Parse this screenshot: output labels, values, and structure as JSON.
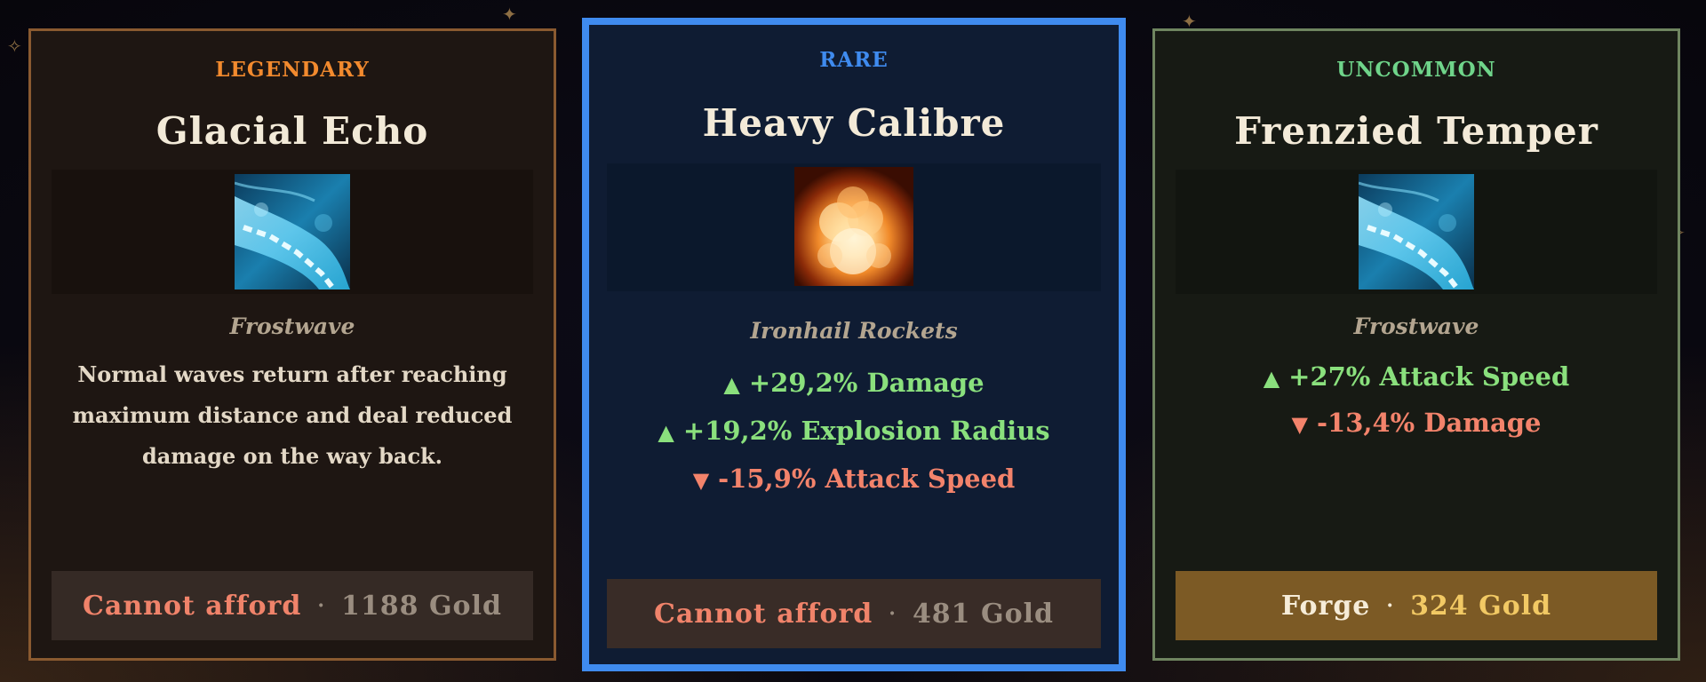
{
  "colors": {
    "legendary": "#f28a2e",
    "rare": "#3f8bef",
    "uncommon": "#6fd48a",
    "stat_up": "#8ae07d",
    "stat_down": "#f3836b",
    "gold": "#f2c964"
  },
  "cards": [
    {
      "rarity": "LEGENDARY",
      "title": "Glacial Echo",
      "icon": "frostwave-icon",
      "weapon": "Frostwave",
      "description": "Normal waves return after reaching maximum distance and deal reduced damage on the way back.",
      "button": {
        "label": "Cannot afford",
        "separator": "·",
        "cost": "1188 Gold",
        "affordable": false
      }
    },
    {
      "rarity": "RARE",
      "title": "Heavy Calibre",
      "icon": "explosion-icon",
      "weapon": "Ironhail Rockets",
      "stats": [
        {
          "direction": "up",
          "arrow": "▲",
          "text": "+29,2% Damage"
        },
        {
          "direction": "up",
          "arrow": "▲",
          "text": "+19,2% Explosion Radius"
        },
        {
          "direction": "down",
          "arrow": "▼",
          "text": "-15,9% Attack Speed"
        }
      ],
      "button": {
        "label": "Cannot afford",
        "separator": "·",
        "cost": "481 Gold",
        "affordable": false
      }
    },
    {
      "rarity": "UNCOMMON",
      "title": "Frenzied Temper",
      "icon": "frostwave-icon",
      "weapon": "Frostwave",
      "stats": [
        {
          "direction": "up",
          "arrow": "▲",
          "text": "+27% Attack Speed"
        },
        {
          "direction": "down",
          "arrow": "▼",
          "text": "-13,4% Damage"
        }
      ],
      "button": {
        "label": "Forge",
        "separator": "·",
        "cost": "324 Gold",
        "affordable": true
      }
    }
  ]
}
